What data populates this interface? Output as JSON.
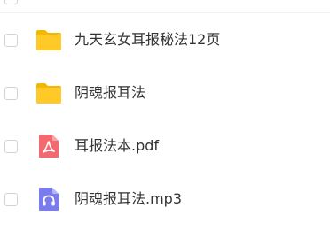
{
  "files": [
    {
      "name": "九天玄女耳报秘法12页",
      "icon": "folder-icon"
    },
    {
      "name": "阴魂报耳法",
      "icon": "folder-icon"
    },
    {
      "name": "耳报法本.pdf",
      "icon": "pdf-file-icon"
    },
    {
      "name": "阴魂报耳法.mp3",
      "icon": "audio-file-icon"
    }
  ],
  "colors": {
    "folder": "#FFCA28",
    "folder_tab": "#F5B800",
    "pdf": "#F26A6F",
    "audio": "#7A7BEE",
    "text": "#333333",
    "checkbox_border": "#CFD3DA"
  }
}
